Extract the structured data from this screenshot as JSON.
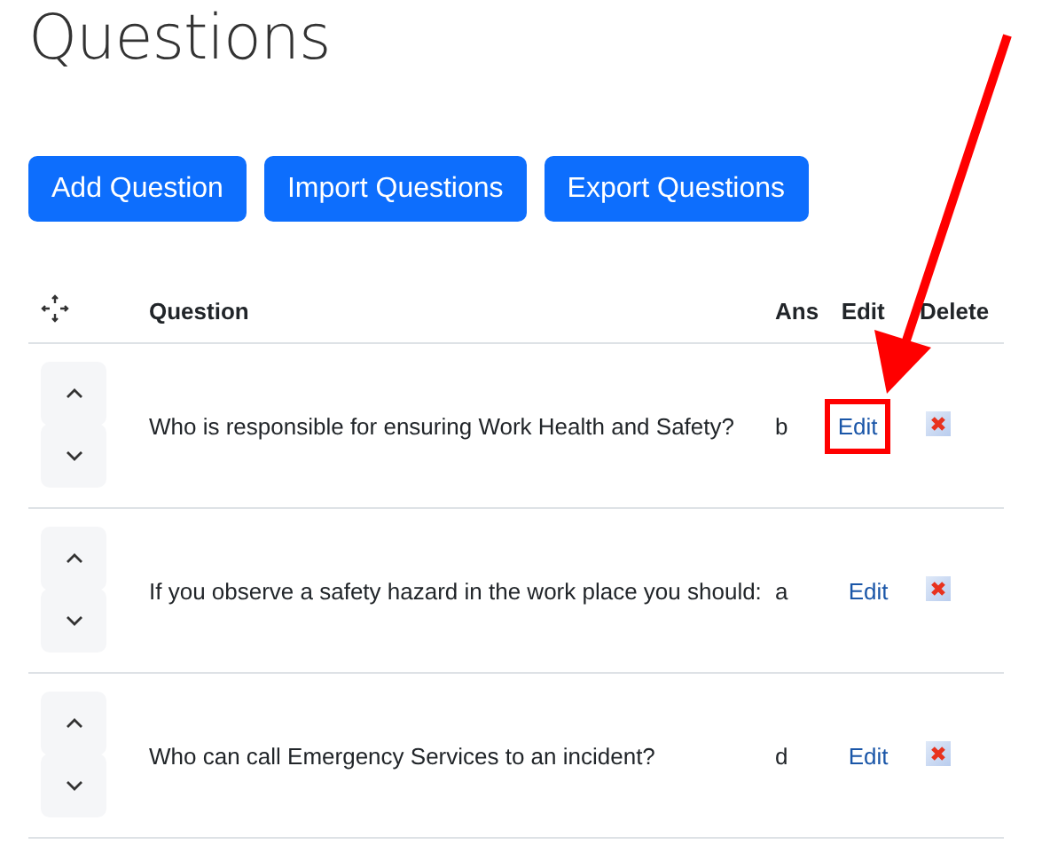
{
  "title": "Questions",
  "buttons": [
    "Add Question",
    "Import Questions",
    "Export Questions"
  ],
  "table": {
    "columns": [
      "Question",
      "Ans",
      "Edit",
      "Delete"
    ],
    "rows": [
      {
        "question": "Who is responsible for ensuring Work Health and Safety?",
        "ans": "b",
        "edit": "Edit",
        "highlighted": true
      },
      {
        "question": "If you observe a safety hazard in the work place you should:",
        "ans": "a",
        "edit": "Edit",
        "highlighted": false
      },
      {
        "question": "Who can call Emergency Services to an incident?",
        "ans": "d",
        "edit": "Edit",
        "highlighted": false
      }
    ]
  }
}
